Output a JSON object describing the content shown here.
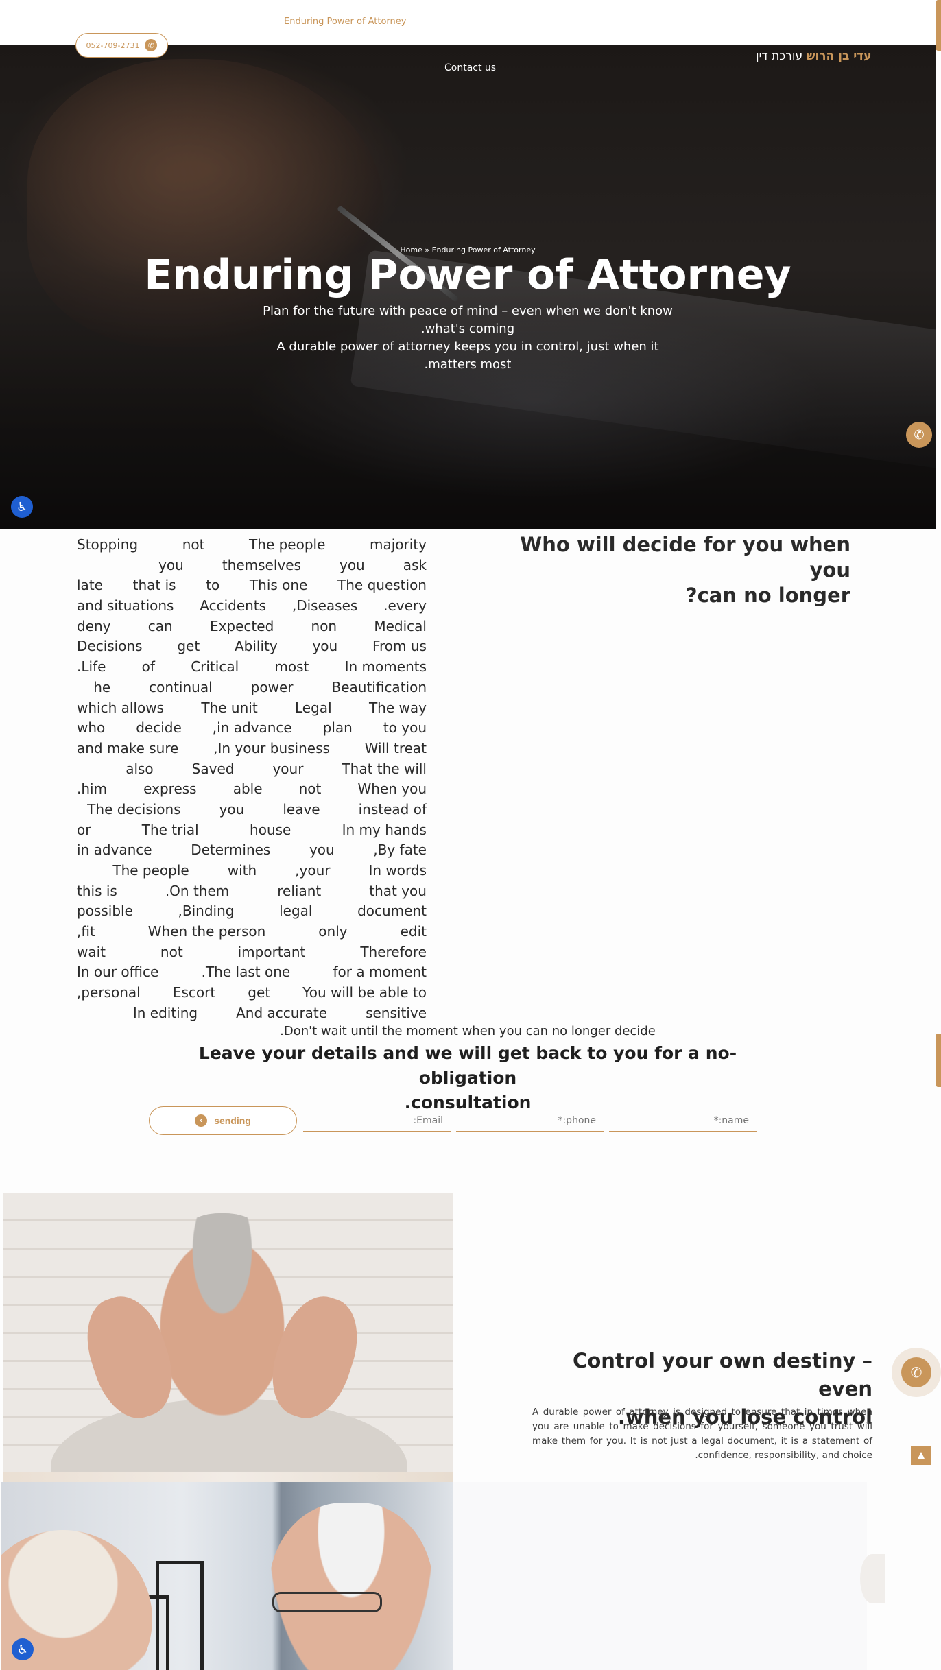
{
  "header": {
    "page_title": "Enduring Power of Attorney",
    "phone": "052-709-2731",
    "logo_name": "עדי בן הרוש",
    "logo_tagline": "עורכת דין",
    "nav_contact": "Contact us"
  },
  "hero": {
    "breadcrumb": "Home » Enduring Power of Attorney",
    "title": "Enduring Power of Attorney",
    "subtitle_lines": [
      "Plan for the future with peace of mind – even when we don't know",
      ".what's coming",
      "A durable power of attorney keeps you in control, just when it",
      ".matters most"
    ]
  },
  "who_section": {
    "title_lines": [
      "Who will decide for you when you",
      "?can no longer"
    ],
    "body_lines": [
      [
        "Stopping",
        "not",
        "The people",
        "majority"
      ],
      [
        "you",
        "themselves",
        "you",
        "ask"
      ],
      [
        "late",
        "that is",
        "to",
        "This one",
        "The question"
      ],
      [
        "and situations",
        "Accidents",
        ",Diseases",
        ".every"
      ],
      [
        "deny",
        "can",
        "Expected",
        "non",
        "Medical"
      ],
      [
        "Decisions",
        "get",
        "Ability",
        "you",
        "From us"
      ],
      [
        ".Life",
        "of",
        "Critical",
        "most",
        "In moments"
      ],
      [
        "he",
        "continual",
        "power",
        "Beautification"
      ],
      [
        "which allows",
        "The unit",
        "Legal",
        "The way"
      ],
      [
        "who",
        "decide",
        ",in advance",
        "plan",
        "to you"
      ],
      [
        "and make sure",
        ",In your business",
        "Will treat"
      ],
      [
        "also",
        "Saved",
        "your",
        "That the will"
      ],
      [
        ".him",
        "express",
        "able",
        "not",
        "When you"
      ],
      [
        "The decisions",
        "you",
        "leave",
        "instead of"
      ],
      [
        "or",
        "The trial",
        "house",
        "In my hands"
      ],
      [
        "in advance",
        "Determines",
        "you",
        ",By fate"
      ],
      [
        "The people",
        "with",
        ",your",
        "In words"
      ],
      [
        "this is",
        ".On them",
        "reliant",
        "that you"
      ],
      [
        "possible",
        ",Binding",
        "legal",
        "document"
      ],
      [
        ",fit",
        "When the person",
        "only",
        "edit"
      ],
      [
        "wait",
        "not",
        "important",
        "Therefore"
      ],
      [
        "In our office",
        ".The last one",
        "for a moment"
      ],
      [
        ",personal",
        "Escort",
        "get",
        "You will be able to"
      ],
      [
        "In editing",
        "And accurate",
        "sensitive"
      ]
    ],
    "last_line": ".Don't wait until the moment when you can no longer decide"
  },
  "form": {
    "title_lines": [
      "Leave your details and we will get back to you for a no-obligation",
      ".consultation"
    ],
    "send_label": "sending",
    "email_placeholder": ":Email",
    "phone_placeholder": "*:phone",
    "name_placeholder": "*:name"
  },
  "destiny_section": {
    "title_lines": [
      "Control your own destiny – even",
      ".when you lose control"
    ],
    "text": "A durable power of attorney is designed to ensure that in times when you are unable to make decisions for yourself, someone you trust will make them for you. It is not just a legal document, it is a statement of .confidence, responsibility, and choice"
  },
  "icons": {
    "phone": "phone-icon",
    "accessibility": "accessibility-icon",
    "scroll_top": "chevron-up-icon",
    "send_arrow": "chevron-left-icon"
  },
  "colors": {
    "accent": "#c9965a",
    "accessibility_blue": "#1f5fd1",
    "text": "#2a2a2a"
  }
}
